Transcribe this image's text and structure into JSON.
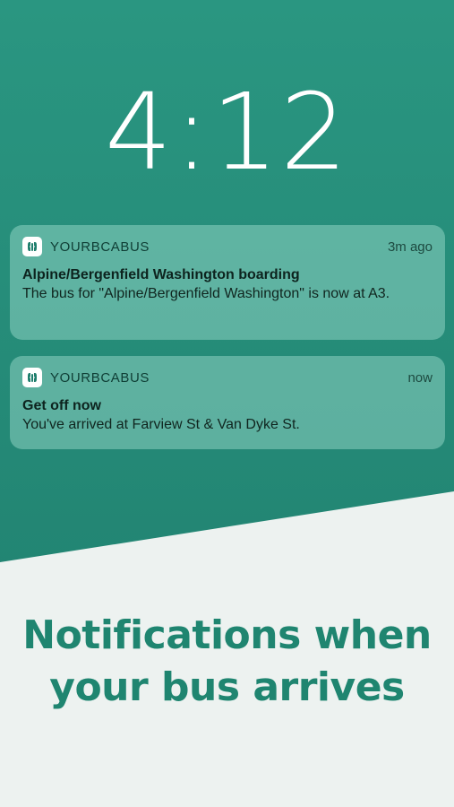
{
  "lockscreen": {
    "time": "4:12"
  },
  "notifications": [
    {
      "app_name": "YOURBCABUS",
      "time_ago": "3m ago",
      "title": "Alpine/Bergenfield Washington boarding",
      "body": "The bus for \"Alpine/Bergenfield Washington\" is now at A3."
    },
    {
      "app_name": "YOURBCABUS",
      "time_ago": "now",
      "title": "Get off now",
      "body": "You've arrived at Farview St & Van Dyke St."
    }
  ],
  "tagline": {
    "line1": "Notifications when",
    "line2": "your bus arrives"
  },
  "icons": {
    "app_icon": "bus-logo-icon"
  },
  "colors": {
    "lock_background": "#258b78",
    "tagline_text": "#1f8570",
    "page_background": "#edf2f0"
  }
}
